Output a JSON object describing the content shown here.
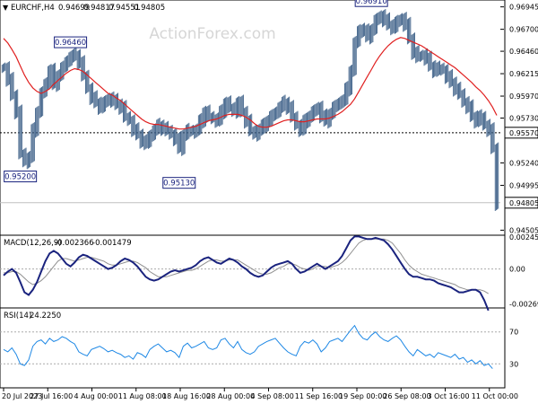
{
  "chart_data": [
    {
      "type": "ohlc",
      "title": "EURCHF,H4",
      "ohlc": {
        "open": "0.94699",
        "high": "0.94817",
        "low": "0.94551",
        "close": "0.94805"
      },
      "watermark": "ActionForex.com",
      "ylim": [
        0.9445,
        0.9702
      ],
      "y_ticks": [
        "0.96945",
        "0.96700",
        "0.96460",
        "0.96215",
        "0.95970",
        "0.95730",
        "0.95240",
        "0.94995",
        "0.94505"
      ],
      "hlines": [
        {
          "label": "0.95570",
          "value": 0.9557,
          "style": "dotted",
          "color": "#000000"
        },
        {
          "label": "0.94805",
          "value": 0.94805,
          "style": "solid",
          "color": "#c0c0c0"
        }
      ],
      "annotations": [
        {
          "text": "0.95200",
          "x_index": 4,
          "value": 0.952
        },
        {
          "text": "0.96460",
          "x_index": 16,
          "value": 0.9646
        },
        {
          "text": "0.95130",
          "x_index": 42,
          "value": 0.9513
        },
        {
          "text": "0.96910",
          "x_index": 88,
          "value": 0.9691
        }
      ],
      "x_tick_labels": [
        "20 Jul 2023",
        "27 Jul 16:00",
        "4 Aug 00:00",
        "11 Aug 08:00",
        "18 Aug 16:00",
        "28 Aug 00:00",
        "4 Sep 08:00",
        "11 Sep 16:00",
        "19 Sep 00:00",
        "26 Sep 08:00",
        "3 Oct 16:00",
        "11 Oct 00:00"
      ],
      "price_path": [
        0.9628,
        0.9615,
        0.9598,
        0.958,
        0.9535,
        0.9525,
        0.953,
        0.956,
        0.958,
        0.96,
        0.9612,
        0.9625,
        0.961,
        0.962,
        0.9628,
        0.9636,
        0.964,
        0.9642,
        0.9634,
        0.962,
        0.9605,
        0.9595,
        0.959,
        0.9585,
        0.959,
        0.9595,
        0.9592,
        0.9588,
        0.9585,
        0.9575,
        0.957,
        0.956,
        0.9555,
        0.9548,
        0.9545,
        0.9555,
        0.956,
        0.9565,
        0.9562,
        0.956,
        0.9555,
        0.955,
        0.954,
        0.9555,
        0.956,
        0.9558,
        0.956,
        0.957,
        0.958,
        0.9575,
        0.9572,
        0.957,
        0.958,
        0.959,
        0.9585,
        0.958,
        0.959,
        0.958,
        0.957,
        0.956,
        0.9555,
        0.956,
        0.9565,
        0.957,
        0.9575,
        0.958,
        0.9585,
        0.959,
        0.9585,
        0.9575,
        0.9565,
        0.956,
        0.957,
        0.9575,
        0.958,
        0.9585,
        0.9575,
        0.957,
        0.9578,
        0.9585,
        0.959,
        0.9592,
        0.9605,
        0.9625,
        0.9655,
        0.967,
        0.9668,
        0.9662,
        0.967,
        0.968,
        0.9685,
        0.968,
        0.9675,
        0.9672,
        0.9678,
        0.9682,
        0.9675,
        0.966,
        0.9645,
        0.964,
        0.9642,
        0.9638,
        0.963,
        0.9625,
        0.9628,
        0.9625,
        0.9618,
        0.9612,
        0.9605,
        0.96,
        0.959,
        0.9585,
        0.9575,
        0.957,
        0.9575,
        0.9565,
        0.956,
        0.954,
        0.948
      ],
      "ma_path": [
        0.966,
        0.9655,
        0.9648,
        0.964,
        0.963,
        0.962,
        0.9612,
        0.9606,
        0.9602,
        0.96,
        0.9602,
        0.9605,
        0.961,
        0.9614,
        0.9618,
        0.9622,
        0.9625,
        0.9627,
        0.9626,
        0.9624,
        0.962,
        0.9616,
        0.9612,
        0.9608,
        0.9604,
        0.96,
        0.9598,
        0.9595,
        0.9592,
        0.9588,
        0.9584,
        0.958,
        0.9576,
        0.9572,
        0.9569,
        0.9567,
        0.9566,
        0.9566,
        0.9565,
        0.9564,
        0.9563,
        0.9562,
        0.9561,
        0.9561,
        0.9562,
        0.9563,
        0.9564,
        0.9566,
        0.9568,
        0.957,
        0.9571,
        0.9572,
        0.9574,
        0.9576,
        0.9577,
        0.9577,
        0.9577,
        0.9576,
        0.9574,
        0.9571,
        0.9567,
        0.9564,
        0.9563,
        0.9563,
        0.9564,
        0.9566,
        0.9568,
        0.957,
        0.9571,
        0.9571,
        0.957,
        0.9569,
        0.9569,
        0.957,
        0.9571,
        0.9572,
        0.9572,
        0.9572,
        0.9573,
        0.9575,
        0.9577,
        0.958,
        0.9584,
        0.9588,
        0.9594,
        0.9602,
        0.961,
        0.9618,
        0.9626,
        0.9634,
        0.9641,
        0.9647,
        0.9652,
        0.9656,
        0.9659,
        0.9661,
        0.966,
        0.9658,
        0.9656,
        0.9654,
        0.9652,
        0.9649,
        0.9646,
        0.9643,
        0.964,
        0.9637,
        0.9634,
        0.9631,
        0.9628,
        0.9624,
        0.962,
        0.9616,
        0.9612,
        0.9607,
        0.9603,
        0.9598,
        0.9592,
        0.9585,
        0.9576
      ],
      "ma_color": "#e02020",
      "bar_color": "#3b5e86"
    },
    {
      "type": "line",
      "title": "MACD(12,26,9)",
      "values_text": [
        "-0.002366",
        "-0.001479"
      ],
      "ylim": [
        -0.003,
        0.0026
      ],
      "y_ticks": [
        "0.002454",
        "0.00",
        "-0.002696"
      ],
      "series": [
        {
          "values": [
            -0.0005,
            -0.0002,
            0.0,
            -0.0003,
            -0.001,
            -0.0018,
            -0.002,
            -0.0016,
            -0.001,
            -0.0002,
            0.0006,
            0.0012,
            0.0014,
            0.0012,
            0.0008,
            0.0004,
            0.0002,
            0.0005,
            0.0009,
            0.0011,
            0.001,
            0.0008,
            0.0006,
            0.0004,
            0.0002,
            0.0,
            0.0001,
            0.0003,
            0.0006,
            0.0008,
            0.0007,
            0.0005,
            0.0002,
            -0.0002,
            -0.0006,
            -0.0008,
            -0.0009,
            -0.0008,
            -0.0006,
            -0.0004,
            -0.0002,
            -0.0001,
            -0.0002,
            -0.0001,
            0.0,
            0.0001,
            0.0003,
            0.0006,
            0.0008,
            0.0009,
            0.0007,
            0.0005,
            0.0004,
            0.0006,
            0.0008,
            0.0007,
            0.0005,
            0.0002,
            0.0,
            -0.0003,
            -0.0005,
            -0.0006,
            -0.0005,
            -0.0002,
            0.0001,
            0.0003,
            0.0004,
            0.0005,
            0.0006,
            0.0004,
            0.0,
            -0.0003,
            -0.0002,
            0.0,
            0.0002,
            0.0004,
            0.0002,
            0.0,
            0.0002,
            0.0004,
            0.0006,
            0.001,
            0.0016,
            0.0022,
            0.0025,
            0.0025,
            0.0024,
            0.0023,
            0.0023,
            0.0024,
            0.0023,
            0.0022,
            0.0019,
            0.0015,
            0.001,
            0.0005,
            0.0,
            -0.0004,
            -0.0006,
            -0.0006,
            -0.0007,
            -0.0008,
            -0.0008,
            -0.0009,
            -0.0011,
            -0.0012,
            -0.0013,
            -0.0014,
            -0.0016,
            -0.0018,
            -0.0018,
            -0.0017,
            -0.0016,
            -0.0016,
            -0.0018,
            -0.0024,
            -0.0032
          ],
          "color": "#1a237e"
        },
        {
          "values": [
            -0.0003,
            -0.0003,
            -0.0002,
            -0.0002,
            -0.0004,
            -0.0007,
            -0.001,
            -0.0012,
            -0.0011,
            -0.0009,
            -0.0006,
            -0.0002,
            0.0002,
            0.0006,
            0.0008,
            0.0008,
            0.0007,
            0.0006,
            0.0007,
            0.0008,
            0.0009,
            0.0009,
            0.0008,
            0.0007,
            0.0006,
            0.0004,
            0.0003,
            0.0003,
            0.0004,
            0.0005,
            0.0006,
            0.0006,
            0.0005,
            0.0003,
            0.0001,
            -0.0002,
            -0.0004,
            -0.0006,
            -0.0006,
            -0.0006,
            -0.0005,
            -0.0004,
            -0.0003,
            -0.0002,
            -0.0001,
            -0.0001,
            0.0,
            0.0002,
            0.0004,
            0.0006,
            0.0007,
            0.0007,
            0.0006,
            0.0006,
            0.0007,
            0.0007,
            0.0007,
            0.0005,
            0.0003,
            0.0001,
            -0.0001,
            -0.0003,
            -0.0004,
            -0.0004,
            -0.0003,
            -0.0001,
            0.0001,
            0.0002,
            0.0004,
            0.0004,
            0.0003,
            0.0001,
            0.0,
            -0.0001,
            0.0,
            0.0002,
            0.0002,
            0.0002,
            0.0001,
            0.0002,
            0.0003,
            0.0005,
            0.0008,
            0.0012,
            0.0016,
            0.002,
            0.0022,
            0.0023,
            0.0023,
            0.0023,
            0.0023,
            0.0023,
            0.0022,
            0.002,
            0.0016,
            0.0012,
            0.0007,
            0.0003,
            0.0,
            -0.0002,
            -0.0004,
            -0.0005,
            -0.0006,
            -0.0007,
            -0.0008,
            -0.0009,
            -0.001,
            -0.0011,
            -0.0012,
            -0.0014,
            -0.0015,
            -0.0016,
            -0.0016,
            -0.0016,
            -0.0016,
            -0.0017,
            -0.0019
          ],
          "color": "#909090"
        }
      ]
    },
    {
      "type": "line",
      "title": "RSI(14)",
      "values_text": [
        "24.2250"
      ],
      "ylim": [
        0,
        100
      ],
      "y_ticks": [
        "70",
        "30"
      ],
      "levels": [
        70,
        30
      ],
      "series": [
        {
          "values": [
            48,
            45,
            50,
            42,
            30,
            28,
            35,
            52,
            58,
            60,
            55,
            62,
            58,
            60,
            64,
            62,
            58,
            55,
            45,
            42,
            40,
            48,
            50,
            52,
            49,
            45,
            47,
            44,
            42,
            38,
            40,
            36,
            44,
            42,
            38,
            48,
            52,
            55,
            50,
            45,
            47,
            44,
            38,
            52,
            56,
            50,
            52,
            55,
            58,
            50,
            48,
            50,
            60,
            62,
            55,
            50,
            58,
            48,
            44,
            42,
            45,
            52,
            55,
            58,
            60,
            62,
            56,
            50,
            45,
            42,
            40,
            52,
            58,
            56,
            60,
            55,
            45,
            50,
            58,
            60,
            62,
            58,
            65,
            72,
            78,
            68,
            62,
            60,
            66,
            70,
            64,
            60,
            58,
            62,
            65,
            60,
            52,
            45,
            40,
            48,
            44,
            40,
            42,
            38,
            44,
            42,
            40,
            38,
            42,
            36,
            38,
            32,
            35,
            30,
            34,
            28,
            30,
            24
          ],
          "color": "#1e88e5"
        }
      ]
    }
  ]
}
